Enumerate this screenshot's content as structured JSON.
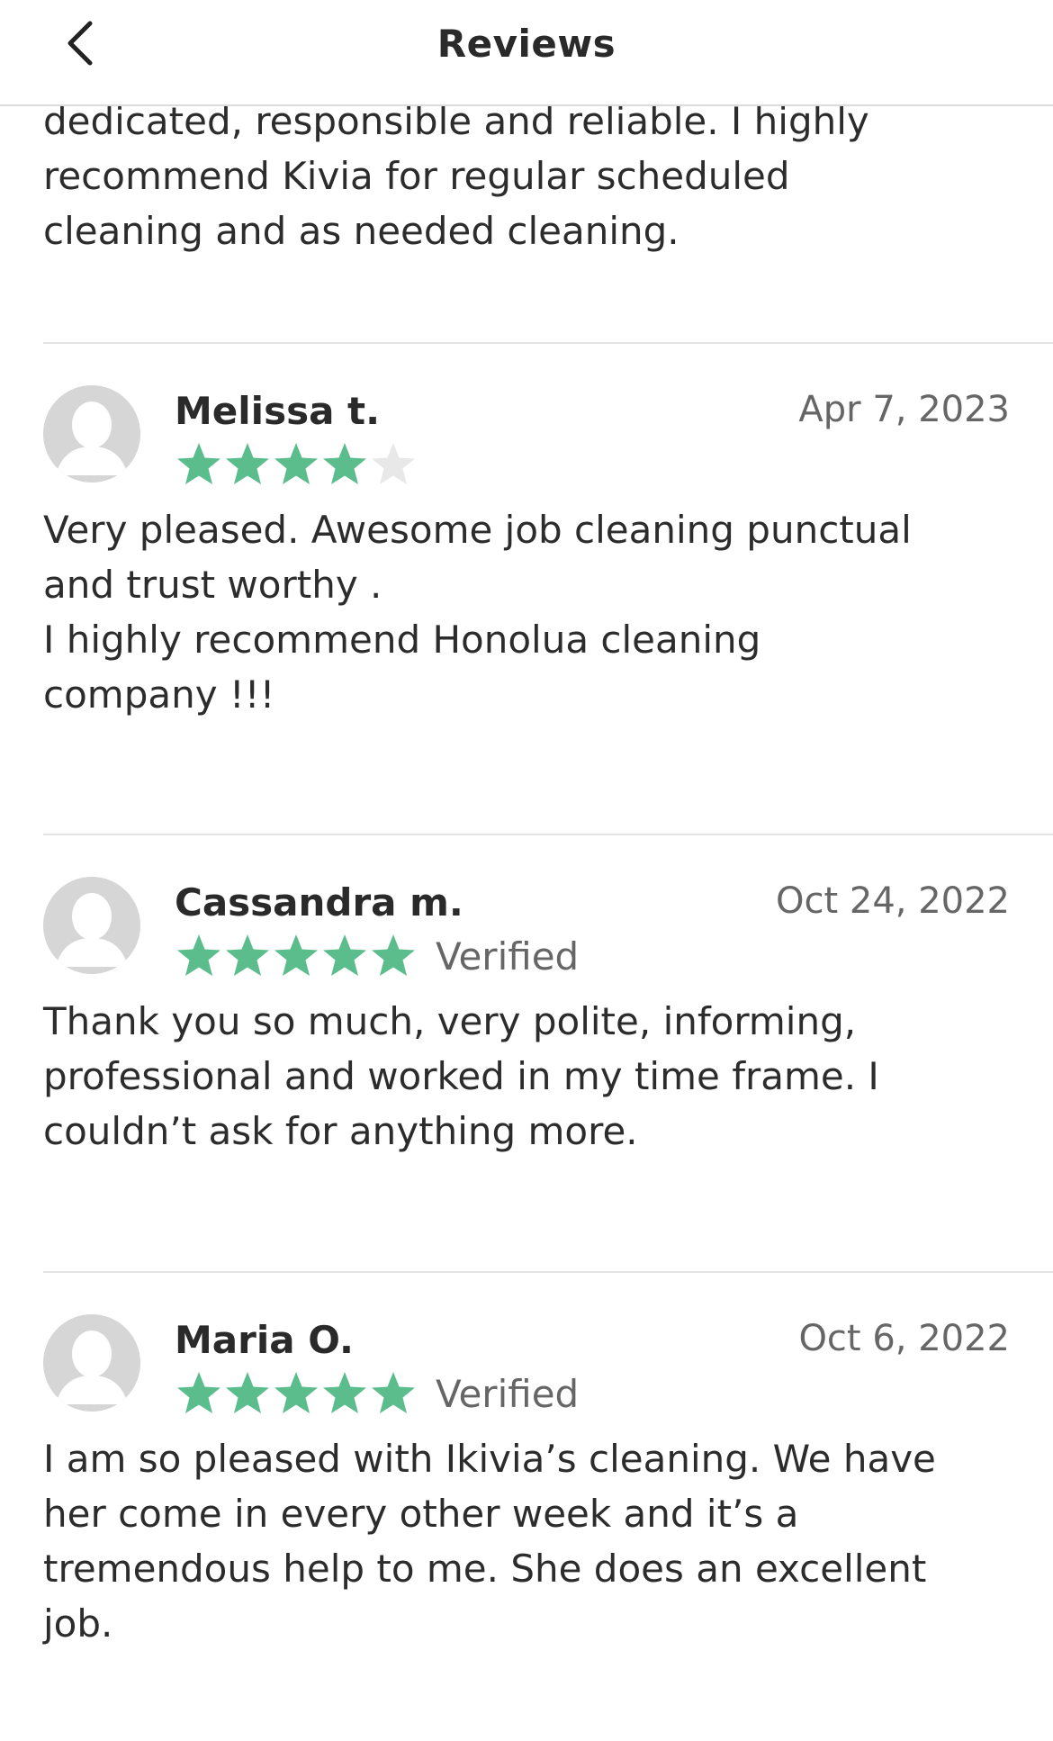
{
  "header": {
    "title": "Reviews",
    "back_icon": "chevron-left-icon"
  },
  "colors": {
    "star_filled": "#5cbd8c",
    "star_empty": "#e8e8e8",
    "avatar_bg": "#d6d6d6"
  },
  "intro_text": "dedicated, responsible and reliable.  I highly\nrecommend Kivia for regular scheduled\ncleaning and as needed cleaning.",
  "reviews": [
    {
      "name": "Melissa t.",
      "date": "Apr 7, 2023",
      "rating": 4,
      "verified": "",
      "text": "Very pleased. Awesome job cleaning punctual\nand trust worthy .\nI highly recommend Honolua cleaning\ncompany !!!"
    },
    {
      "name": "Cassandra m.",
      "date": "Oct 24, 2022",
      "rating": 5,
      "verified": "Verified",
      "text": "Thank you so much, very polite, informing,\nprofessional and worked in my time frame.  I\ncouldn’t ask for anything more."
    },
    {
      "name": "Maria O.",
      "date": "Oct 6, 2022",
      "rating": 5,
      "verified": "Verified",
      "text": "I am so pleased with Ikivia’s cleaning. We have\nher come in every other week and it’s a\ntremendous help to me. She does an excellent\njob."
    }
  ]
}
